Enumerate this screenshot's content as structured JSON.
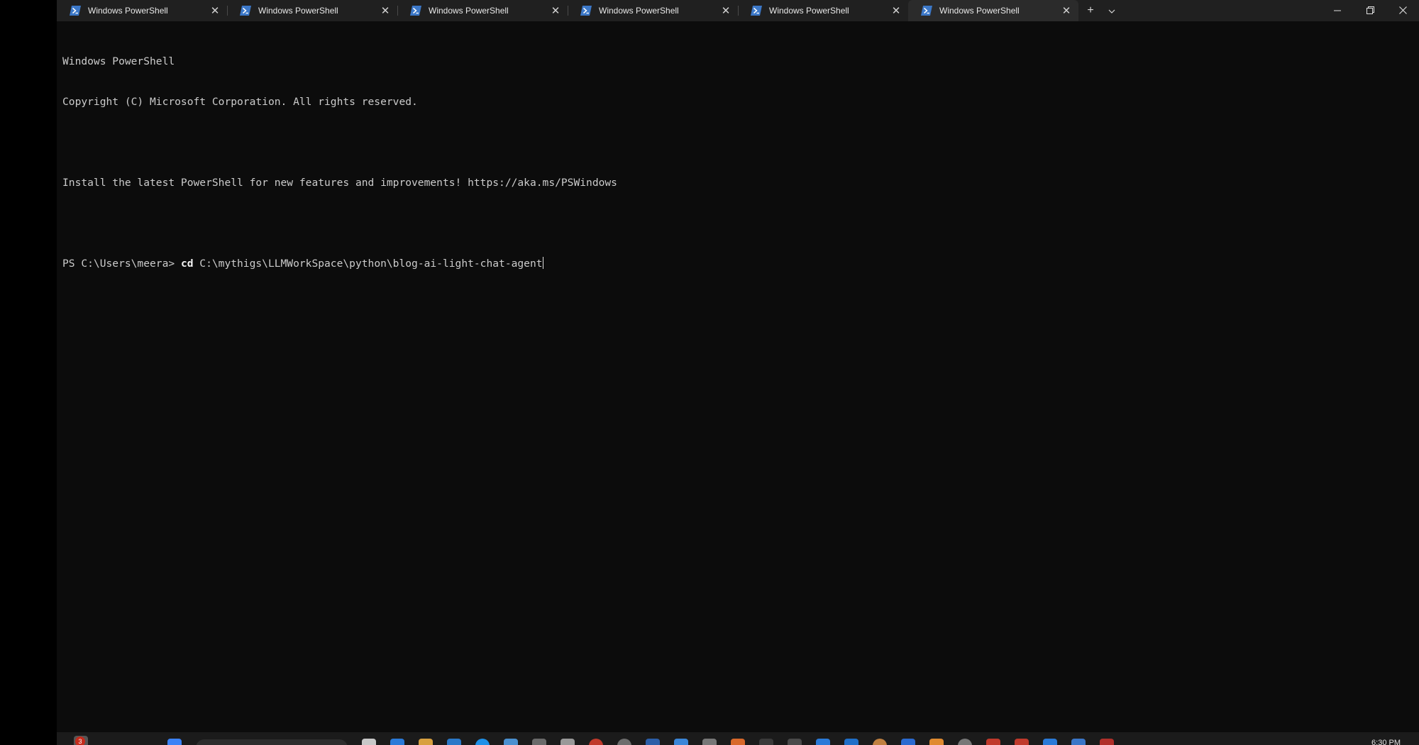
{
  "window": {
    "tabs": [
      {
        "title": "Windows PowerShell",
        "active": false
      },
      {
        "title": "Windows PowerShell",
        "active": false
      },
      {
        "title": "Windows PowerShell",
        "active": false
      },
      {
        "title": "Windows PowerShell",
        "active": false
      },
      {
        "title": "Windows PowerShell",
        "active": false
      },
      {
        "title": "Windows PowerShell",
        "active": true
      }
    ],
    "tab_icon": "powershell-icon",
    "new_tab_icon": "plus-icon",
    "dropdown_icon": "chevron-down-icon",
    "controls": {
      "minimize_icon": "minimize-icon",
      "maximize_icon": "restore-icon",
      "close_icon": "close-icon"
    }
  },
  "terminal": {
    "lines": [
      "Windows PowerShell",
      "Copyright (C) Microsoft Corporation. All rights reserved.",
      "",
      "Install the latest PowerShell for new features and improvements! https://aka.ms/PSWindows",
      ""
    ],
    "prompt": "PS C:\\Users\\meera> ",
    "command_keyword": "cd",
    "command_args": " C:\\mythigs\\LLMWorkSpace\\python\\blog-ai-light-chat-agent"
  },
  "taskbar": {
    "notification_count": "3",
    "clock": "6:30 PM"
  },
  "colors": {
    "terminal_bg": "#0c0c0c",
    "tabbar_bg": "#202020",
    "active_tab_bg": "#2b2b2b",
    "text": "#cccccc",
    "powershell_blue": "#3c78c8"
  }
}
